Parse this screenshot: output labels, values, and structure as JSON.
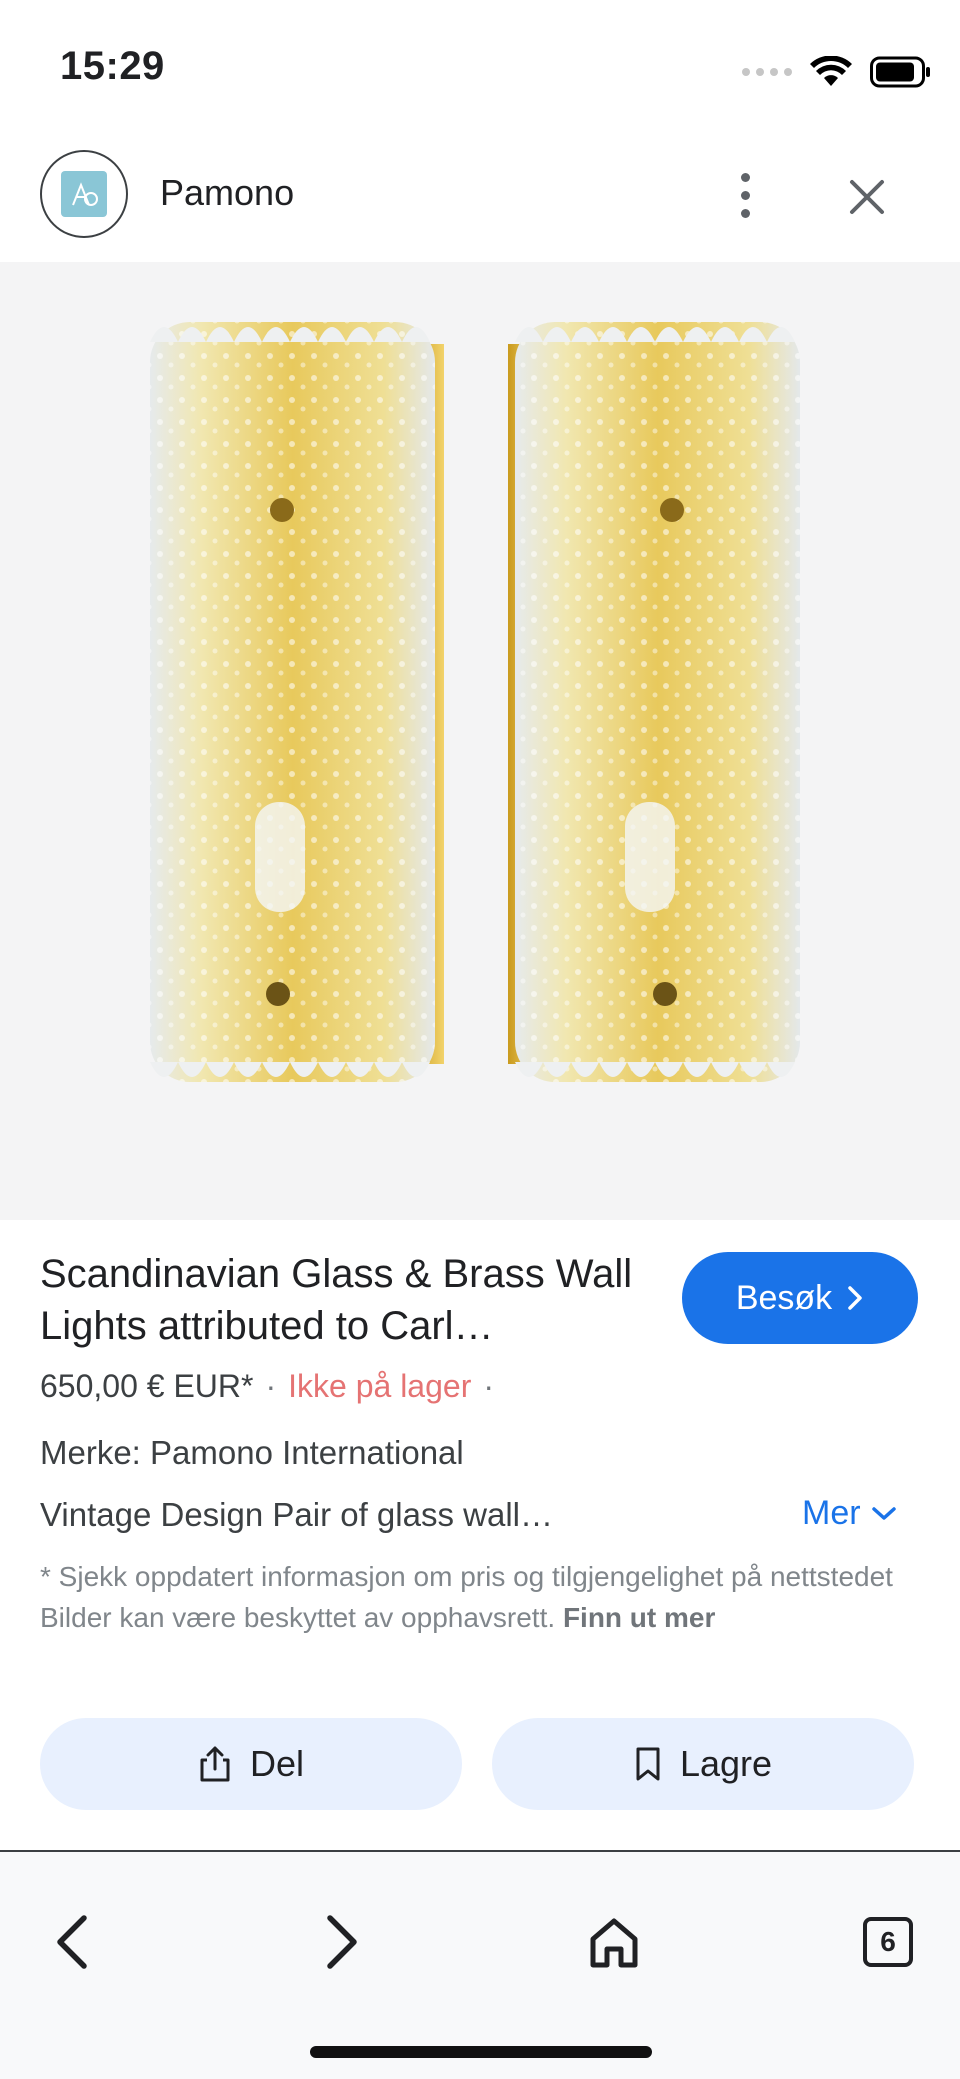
{
  "status_bar": {
    "time": "15:29",
    "icons": [
      "cellular-signal-icon",
      "wifi-icon",
      "battery-icon"
    ]
  },
  "header": {
    "site_name": "Pamono",
    "logo_icon": "pamono-logo-icon",
    "menu_icon": "more-vertical-icon",
    "close_icon": "close-icon"
  },
  "product": {
    "title": "Scandinavian Glass & Brass Wall Lights attributed to Carl…",
    "visit_label": "Besøk",
    "price": "650,00 € EUR*",
    "separator": "·",
    "stock_status": "Ikke på lager",
    "brand": "Merke: Pamono International",
    "description": "Vintage Design Pair of glass wall…",
    "more_label": "Mer",
    "disclaimer": "* Sjekk oppdatert informasjon om pris og tilgjengelighet på nettstedet Bilder kan være beskyttet av opphavsrett.",
    "disclaimer_link": "Finn ut mer"
  },
  "actions": {
    "share_label": "Del",
    "save_label": "Lagre"
  },
  "toolbar": {
    "tabs_count": "6",
    "items": [
      "back-icon",
      "forward-icon",
      "home-icon",
      "tabs-icon"
    ]
  },
  "colors": {
    "accent": "#1a73e8",
    "stock_status": "#e57373",
    "action_bg": "#e8f0fe",
    "image_bg": "#f4f4f5"
  }
}
